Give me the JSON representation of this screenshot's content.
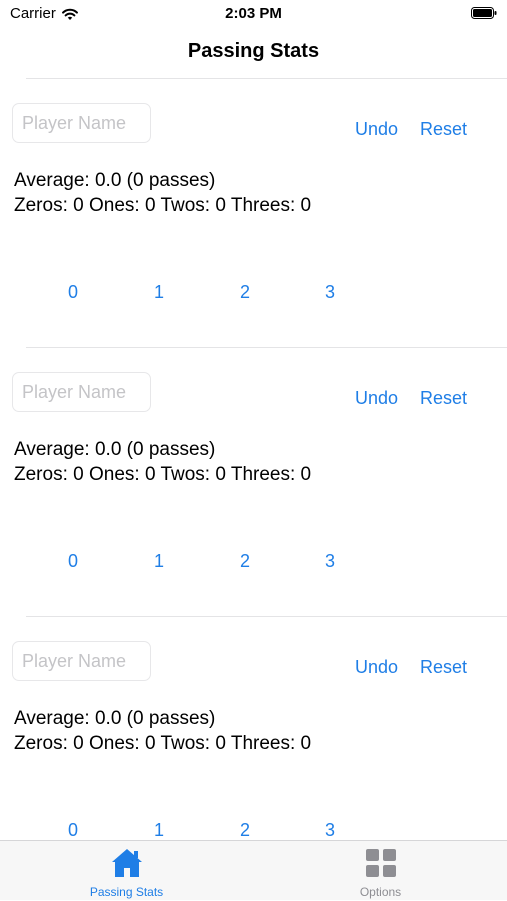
{
  "status_bar": {
    "carrier": "Carrier",
    "time": "2:03 PM",
    "wifi_icon": "wifi-icon",
    "battery_icon": "battery-icon"
  },
  "nav": {
    "title": "Passing Stats"
  },
  "players": [
    {
      "name_placeholder": "Player Name",
      "name_value": "",
      "undo_label": "Undo",
      "reset_label": "Reset",
      "average_text": "Average: 0.0 (0 passes)",
      "counts_text": "Zeros: 0 Ones: 0 Twos: 0 Threes: 0",
      "score_buttons": [
        "0",
        "1",
        "2",
        "3"
      ]
    },
    {
      "name_placeholder": "Player Name",
      "name_value": "",
      "undo_label": "Undo",
      "reset_label": "Reset",
      "average_text": "Average: 0.0 (0 passes)",
      "counts_text": "Zeros: 0 Ones: 0 Twos: 0 Threes: 0",
      "score_buttons": [
        "0",
        "1",
        "2",
        "3"
      ]
    },
    {
      "name_placeholder": "Player Name",
      "name_value": "",
      "undo_label": "Undo",
      "reset_label": "Reset",
      "average_text": "Average: 0.0 (0 passes)",
      "counts_text": "Zeros: 0 Ones: 0 Twos: 0 Threes: 0",
      "score_buttons": [
        "0",
        "1",
        "2",
        "3"
      ]
    }
  ],
  "tab_bar": {
    "tabs": [
      {
        "label": "Passing Stats",
        "icon": "home-icon",
        "selected": true
      },
      {
        "label": "Options",
        "icon": "grid-icon",
        "selected": false
      }
    ]
  },
  "colors": {
    "accent": "#1f7ee6",
    "inactive": "#8e8e93",
    "placeholder": "#c4c4c7",
    "divider": "#e4e4e6"
  }
}
